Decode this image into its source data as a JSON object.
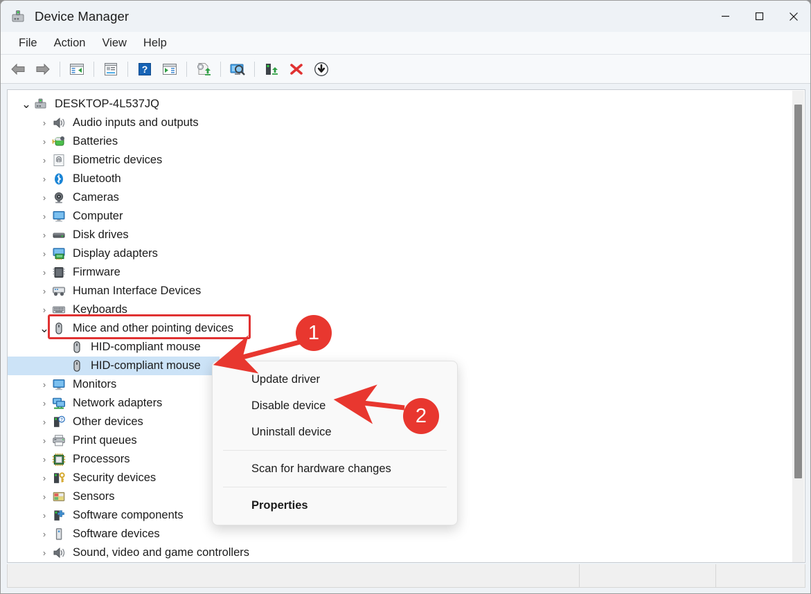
{
  "window": {
    "title": "Device Manager",
    "icon": "device-manager-icon",
    "controls": [
      {
        "name": "minimize",
        "glyph": "—"
      },
      {
        "name": "maximize",
        "glyph": "□"
      },
      {
        "name": "close",
        "glyph": "✕"
      }
    ]
  },
  "menubar": {
    "items": [
      {
        "label": "File"
      },
      {
        "label": "Action"
      },
      {
        "label": "View"
      },
      {
        "label": "Help"
      }
    ]
  },
  "toolbar": {
    "buttons": [
      {
        "name": "back-icon",
        "tip": "Back"
      },
      {
        "name": "forward-icon",
        "tip": "Forward"
      },
      {
        "name": "show-hide-console-tree-icon",
        "tip": "Show/hide console tree"
      },
      {
        "name": "properties-icon",
        "tip": "Properties"
      },
      {
        "name": "help-icon",
        "tip": "Help"
      },
      {
        "name": "show-hide-action-pane-icon",
        "tip": "Show/hide action pane"
      },
      {
        "name": "update-driver-icon",
        "tip": "Update driver"
      },
      {
        "name": "scan-hardware-changes-icon",
        "tip": "Scan for hardware changes"
      },
      {
        "name": "enable-device-icon",
        "tip": "Enable device"
      },
      {
        "name": "uninstall-device-icon",
        "tip": "Uninstall device"
      },
      {
        "name": "disable-device-icon",
        "tip": "Disable device"
      }
    ]
  },
  "tree": {
    "root": {
      "label": "DESKTOP-4L537JQ",
      "icon": "computer-device-icon",
      "expanded": true
    },
    "items": [
      {
        "label": "Audio inputs and outputs",
        "icon": "speaker-icon",
        "level": 1,
        "expandable": true,
        "expanded": false,
        "selected": false
      },
      {
        "label": "Batteries",
        "icon": "battery-icon",
        "level": 1,
        "expandable": true,
        "expanded": false,
        "selected": false
      },
      {
        "label": "Biometric devices",
        "icon": "fingerprint-icon",
        "level": 1,
        "expandable": true,
        "expanded": false,
        "selected": false
      },
      {
        "label": "Bluetooth",
        "icon": "bluetooth-icon",
        "level": 1,
        "expandable": true,
        "expanded": false,
        "selected": false
      },
      {
        "label": "Cameras",
        "icon": "camera-icon",
        "level": 1,
        "expandable": true,
        "expanded": false,
        "selected": false
      },
      {
        "label": "Computer",
        "icon": "monitor-icon",
        "level": 1,
        "expandable": true,
        "expanded": false,
        "selected": false
      },
      {
        "label": "Disk drives",
        "icon": "disk-drive-icon",
        "level": 1,
        "expandable": true,
        "expanded": false,
        "selected": false
      },
      {
        "label": "Display adapters",
        "icon": "display-adapter-icon",
        "level": 1,
        "expandable": true,
        "expanded": false,
        "selected": false
      },
      {
        "label": "Firmware",
        "icon": "chip-icon",
        "level": 1,
        "expandable": true,
        "expanded": false,
        "selected": false
      },
      {
        "label": "Human Interface Devices",
        "icon": "hid-icon",
        "level": 1,
        "expandable": true,
        "expanded": false,
        "selected": false
      },
      {
        "label": "Keyboards",
        "icon": "keyboard-icon",
        "level": 1,
        "expandable": true,
        "expanded": false,
        "selected": false
      },
      {
        "label": "Mice and other pointing devices",
        "icon": "mouse-icon",
        "level": 1,
        "expandable": true,
        "expanded": true,
        "selected": false
      },
      {
        "label": "HID-compliant mouse",
        "icon": "mouse-icon",
        "level": 2,
        "expandable": false,
        "expanded": false,
        "selected": false
      },
      {
        "label": "HID-compliant mouse",
        "icon": "mouse-icon",
        "level": 2,
        "expandable": false,
        "expanded": false,
        "selected": true
      },
      {
        "label": "Monitors",
        "icon": "monitor-icon",
        "level": 1,
        "expandable": true,
        "expanded": false,
        "selected": false
      },
      {
        "label": "Network adapters",
        "icon": "network-adapter-icon",
        "level": 1,
        "expandable": true,
        "expanded": false,
        "selected": false
      },
      {
        "label": "Other devices",
        "icon": "other-device-icon",
        "level": 1,
        "expandable": true,
        "expanded": false,
        "selected": false
      },
      {
        "label": "Print queues",
        "icon": "printer-icon",
        "level": 1,
        "expandable": true,
        "expanded": false,
        "selected": false
      },
      {
        "label": "Processors",
        "icon": "processor-icon",
        "level": 1,
        "expandable": true,
        "expanded": false,
        "selected": false
      },
      {
        "label": "Security devices",
        "icon": "security-device-icon",
        "level": 1,
        "expandable": true,
        "expanded": false,
        "selected": false
      },
      {
        "label": "Sensors",
        "icon": "sensor-icon",
        "level": 1,
        "expandable": true,
        "expanded": false,
        "selected": false
      },
      {
        "label": "Software components",
        "icon": "software-component-icon",
        "level": 1,
        "expandable": true,
        "expanded": false,
        "selected": false
      },
      {
        "label": "Software devices",
        "icon": "software-device-icon",
        "level": 1,
        "expandable": true,
        "expanded": false,
        "selected": false
      },
      {
        "label": "Sound, video and game controllers",
        "icon": "speaker-icon",
        "level": 1,
        "expandable": true,
        "expanded": false,
        "selected": false
      }
    ]
  },
  "context_menu": {
    "items": [
      {
        "label": "Update driver",
        "type": "item",
        "bold": false
      },
      {
        "label": "Disable device",
        "type": "item",
        "bold": false
      },
      {
        "label": "Uninstall device",
        "type": "item",
        "bold": false
      },
      {
        "label": "",
        "type": "separator"
      },
      {
        "label": "Scan for hardware changes",
        "type": "item",
        "bold": false
      },
      {
        "label": "",
        "type": "separator"
      },
      {
        "label": "Properties",
        "type": "item",
        "bold": true
      }
    ]
  },
  "annotations": {
    "accent_color": "#e8372f",
    "highlight_box_color": "#e03131",
    "steps": [
      {
        "number": "1",
        "points_to": "HID-compliant mouse (selected)"
      },
      {
        "number": "2",
        "points_to": "Disable device"
      }
    ]
  },
  "statusbar": {
    "panels": [
      "",
      "",
      ""
    ]
  }
}
